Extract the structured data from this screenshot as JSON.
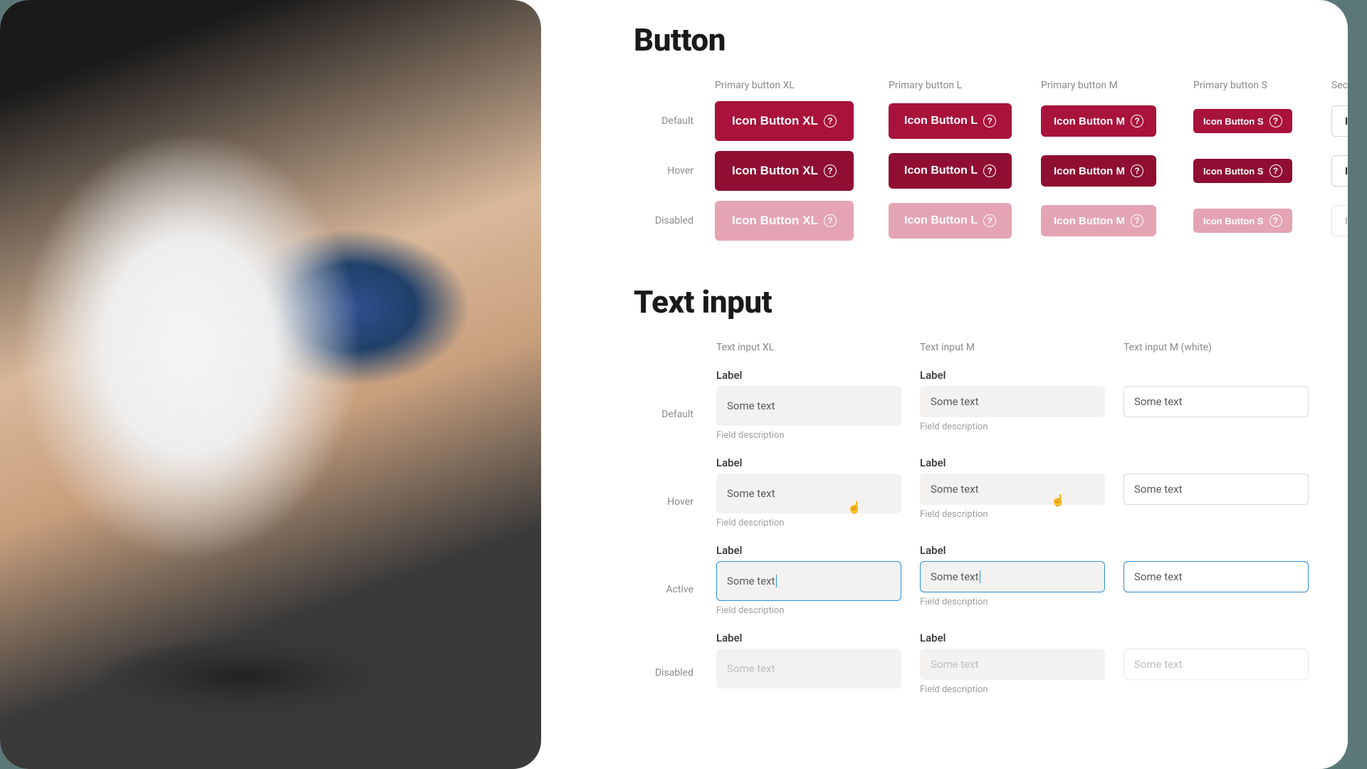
{
  "headings": {
    "button": "Button",
    "text_input": "Text input"
  },
  "button_columns": {
    "xl": "Primary button XL",
    "l": "Primary button L",
    "m": "Primary button M",
    "s": "Primary button S",
    "secondary_m": "Secondary button M"
  },
  "row_labels": {
    "default": "Default",
    "hover": "Hover",
    "disabled": "Disabled",
    "active": "Active"
  },
  "button_text": {
    "xl": "Icon Button XL",
    "l": "Icon Button L",
    "m": "Icon Button M",
    "s": "Icon Button S"
  },
  "input_columns": {
    "xl": "Text input XL",
    "m": "Text input M",
    "m_white": "Text input M (white)"
  },
  "input": {
    "label": "Label",
    "value": "Some text",
    "description": "Field description"
  },
  "colors": {
    "primary": "#a9123b",
    "primary_hover": "#8f0e32",
    "primary_disabled": "#e4a4b4",
    "active_border": "#2e8fd8"
  }
}
